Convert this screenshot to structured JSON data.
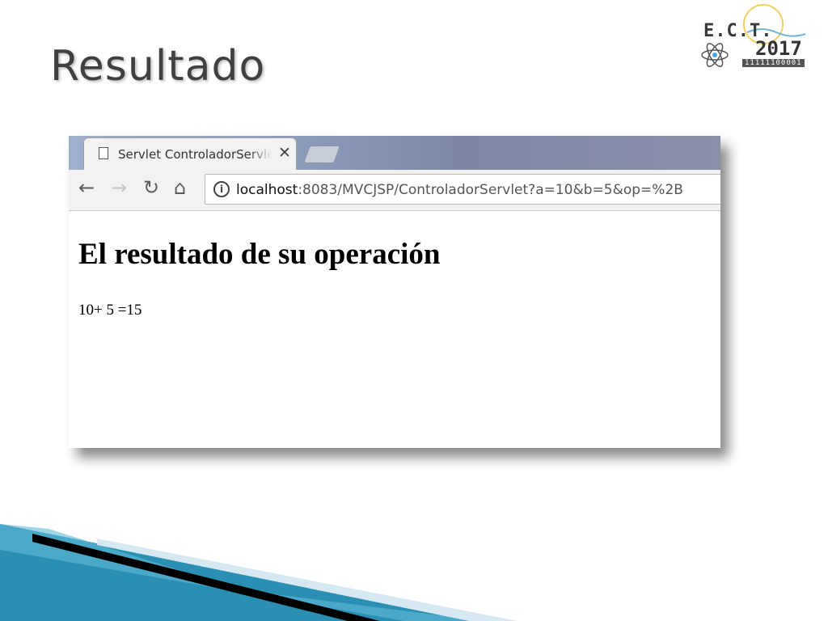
{
  "slide": {
    "title": "Resultado"
  },
  "logo": {
    "ect": "E.C.T.",
    "year": "2017",
    "binary": "11111100001"
  },
  "browser": {
    "tab": {
      "title": "Servlet ControladorServlet",
      "close_icon": "close-icon",
      "page_icon": "page-icon"
    },
    "toolbar": {
      "back_icon": "back-arrow-icon",
      "forward_icon": "forward-arrow-icon",
      "reload_icon": "reload-icon",
      "home_icon": "home-icon",
      "info_icon": "info-icon"
    },
    "url": {
      "host": "localhost",
      "rest": ":8083/MVCJSP/ControladorServlet?a=10&b=5&op=%2B"
    },
    "page": {
      "heading": "El resultado de su operación",
      "result": "10+ 5 =15"
    }
  },
  "colors": {
    "title_text": "#404040",
    "deco_blue": "#2b8fb3",
    "deco_light": "#d6e9f2",
    "deco_black": "#000000"
  }
}
